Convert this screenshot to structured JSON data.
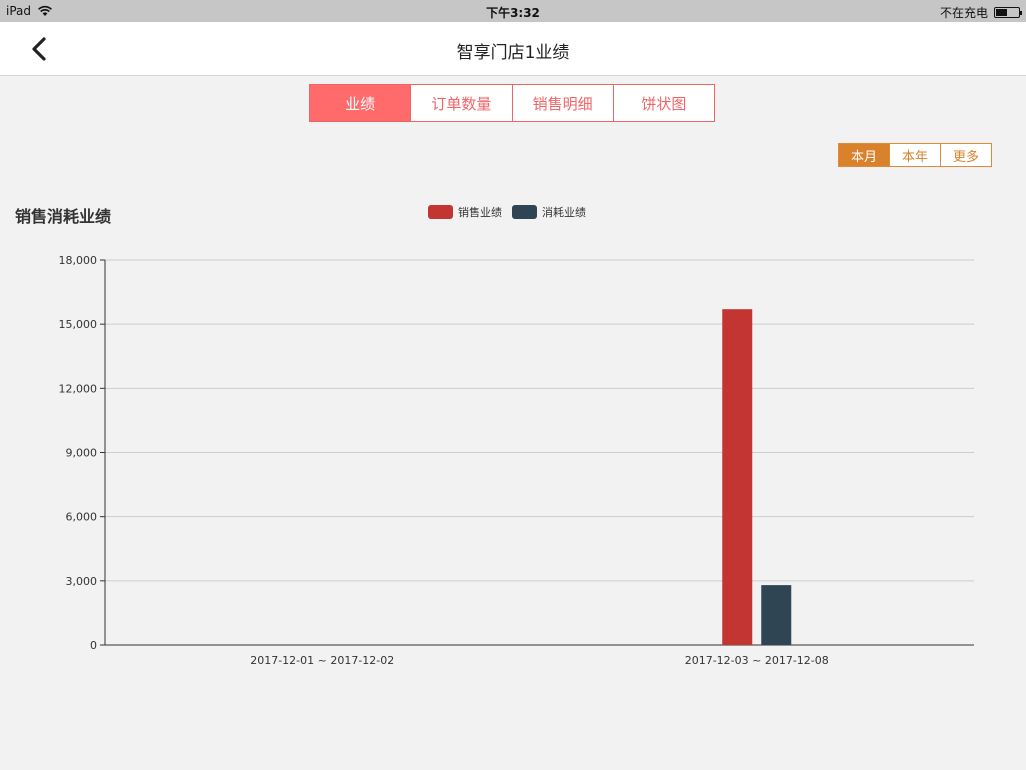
{
  "status_bar": {
    "device": "iPad",
    "time": "下午3:32",
    "charging": "不在充电",
    "battery_level": 0.45
  },
  "nav": {
    "title": "智享门店1业绩"
  },
  "tabs": [
    {
      "label": "业绩",
      "active": true
    },
    {
      "label": "订单数量",
      "active": false
    },
    {
      "label": "销售明细",
      "active": false
    },
    {
      "label": "饼状图",
      "active": false
    }
  ],
  "range_tabs": [
    {
      "label": "本月",
      "active": true
    },
    {
      "label": "本年",
      "active": false
    },
    {
      "label": "更多",
      "active": false
    }
  ],
  "colors": {
    "tab_accent": "#f06567",
    "range_accent": "#d9822b",
    "sales": "#c23531",
    "consumption": "#2f4554"
  },
  "chart_data": {
    "type": "bar",
    "title": "销售消耗业绩",
    "categories": [
      "2017-12-01 ~ 2017-12-02",
      "2017-12-03 ~ 2017-12-08"
    ],
    "series": [
      {
        "name": "销售业绩",
        "values": [
          0,
          15700
        ]
      },
      {
        "name": "消耗业绩",
        "values": [
          0,
          2800
        ]
      }
    ],
    "ylim": [
      0,
      18000
    ],
    "yticks": [
      0,
      3000,
      6000,
      9000,
      12000,
      15000,
      18000
    ],
    "ytick_labels": [
      "0",
      "3,000",
      "6,000",
      "9,000",
      "12,000",
      "15,000",
      "18,000"
    ],
    "grid": true,
    "legend_position": "top-center"
  }
}
